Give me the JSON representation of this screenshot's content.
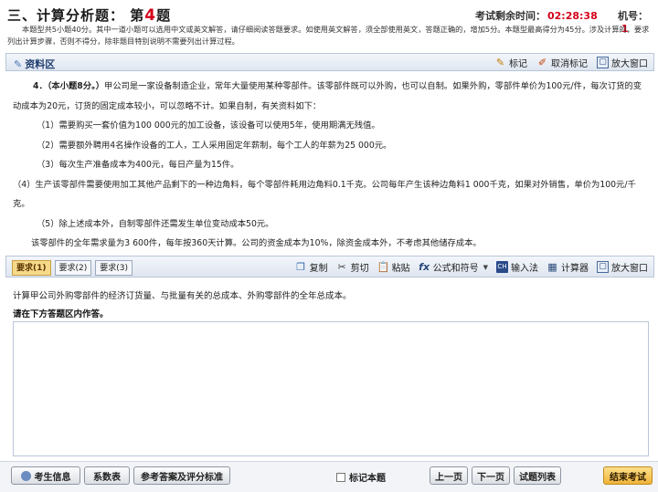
{
  "header": {
    "section": "三、计算分析题：",
    "question_prefix": "第",
    "question_number": "4",
    "question_suffix": "题",
    "timer_label": "考试剩余时间：",
    "timer_value": "02:28:38",
    "machine_label": "机号：",
    "machine_value": "1",
    "instructions": "本题型共5小题40分。其中一道小题可以选用中文或英文解答，请仔细阅读答题要求。如使用英文解答，须全部使用英文，答题正确的，增加5分。本题型最高得分为45分。涉及计算的，要求列出计算步骤，否则不得分，除非题目特别说明不需要列出计算过程。"
  },
  "material_bar": {
    "label": "资料区",
    "tools": [
      {
        "icon": "pen-icon",
        "label": "标记"
      },
      {
        "icon": "cancel-mark-icon",
        "label": "取消标记"
      },
      {
        "icon": "maximize-icon",
        "label": "放大窗口"
      }
    ]
  },
  "material": {
    "title": "4．（本小题8分。）",
    "intro": "甲公司是一家设备制造企业，常年大量使用某种零部件。该零部件既可以外购，也可以自制。如果外购，零部件单价为100元/件，每次订货的变动成本为20元，订货的固定成本较小，可以忽略不计。如果自制，有关资料如下：",
    "items": [
      "（1）需要购买一套价值为100 000元的加工设备，该设备可以使用5年，使用期满无残值。",
      "（2）需要额外聘用4名操作设备的工人，工人采用固定年薪制，每个工人的年薪为25 000元。",
      "（3）每次生产准备成本为400元，每日产量为15件。",
      "（4）生产该零部件需要使用加工其他产品剩下的一种边角料，每个零部件耗用边角料0.1千克。公司每年产生该种边角料1 000千克，如果对外销售，单价为100元/千克。",
      "（5）除上述成本外，自制零部件还需发生单位变动成本50元。"
    ],
    "closing": "该零部件的全年需求量为3 600件，每年按360天计算。公司的资金成本为10%，除资金成本外，不考虑其他储存成本。"
  },
  "answer_bar": {
    "tabs": [
      "要求(1)",
      "要求(2)",
      "要求(3)"
    ],
    "tools": [
      {
        "icon": "copy-icon",
        "label": "复制"
      },
      {
        "icon": "cut-icon",
        "label": "剪切"
      },
      {
        "icon": "paste-icon",
        "label": "粘贴"
      },
      {
        "icon": "formula-icon",
        "label": "公式和符号"
      },
      {
        "icon": "ime-icon",
        "label": "输入法"
      },
      {
        "icon": "calculator-icon",
        "label": "计算器"
      },
      {
        "icon": "maximize-icon",
        "label": "放大窗口"
      }
    ]
  },
  "question": "计算甲公司外购零部件的经济订货量、与批量有关的总成本、外购零部件的全年总成本。",
  "answer_prompt": "请在下方答题区内作答。",
  "answer_value": "",
  "footer": {
    "candidate_info": "考生信息",
    "coefficient_table": "系数表",
    "reference_answer": "参考答案及评分标准",
    "mark_question": "标记本题",
    "prev": "上一页",
    "next": "下一页",
    "question_list": "试题列表",
    "end_exam": "结束考试"
  },
  "colors": {
    "accent_red": "#d4001a",
    "toolbar_blue": "#1e3c6e",
    "active_tab": "#f7d98a",
    "end_button": "#f0b43a"
  }
}
